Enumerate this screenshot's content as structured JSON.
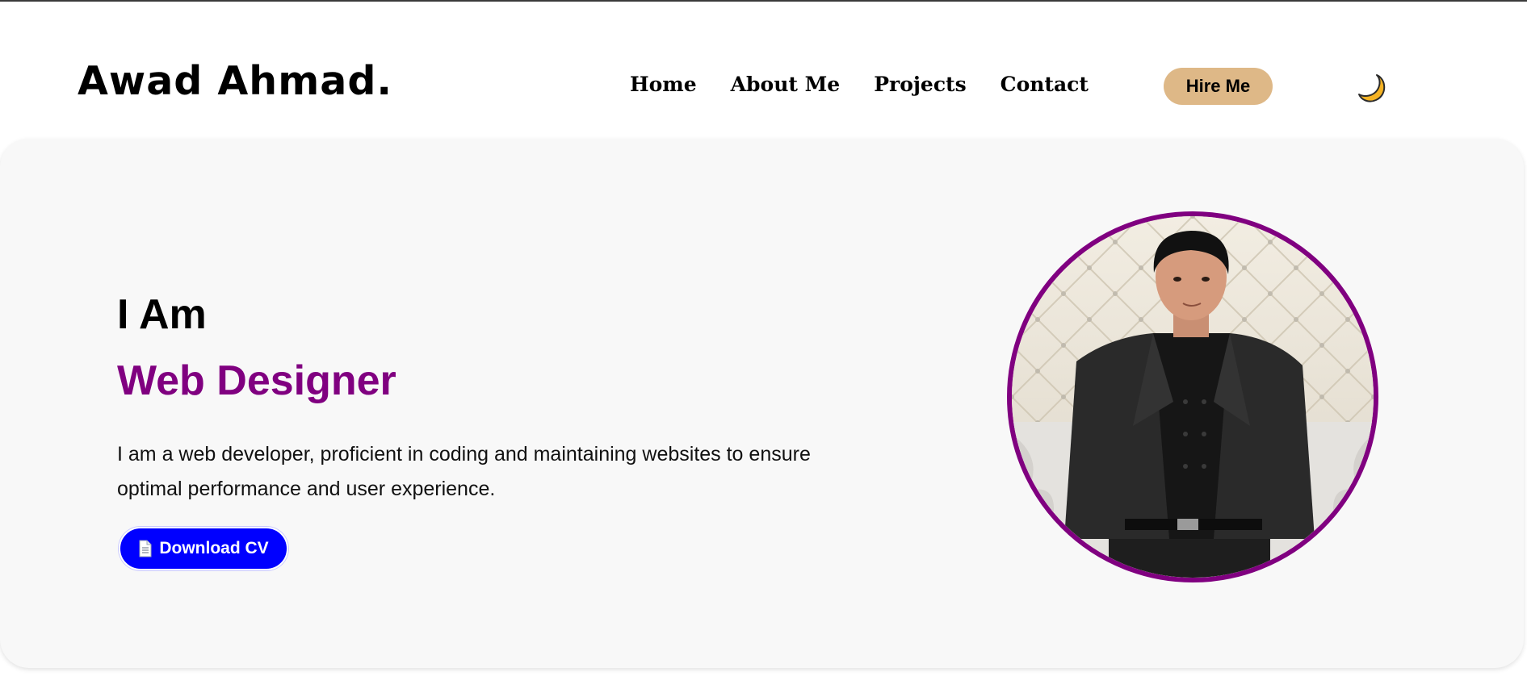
{
  "brand": {
    "name": "Awad Ahmad."
  },
  "nav": {
    "links": [
      "Home",
      "About Me",
      "Projects",
      "Contact"
    ],
    "cta_label": "Hire Me",
    "theme_toggle_icon": "crescent-moon-icon"
  },
  "hero": {
    "eyebrow": "I Am",
    "role": "Web Designer",
    "description": "I am a web developer, proficient in coding and maintaining websites to ensure optimal performance and user experience.",
    "cv_button_label": "Download CV",
    "cv_button_icon": "document-icon"
  },
  "colors": {
    "accent_purple": "#800080",
    "cta_tan": "#deb887",
    "button_blue": "#0000ff",
    "hero_background": "#f8f8f8",
    "moon_yellow": "#f5b324"
  }
}
